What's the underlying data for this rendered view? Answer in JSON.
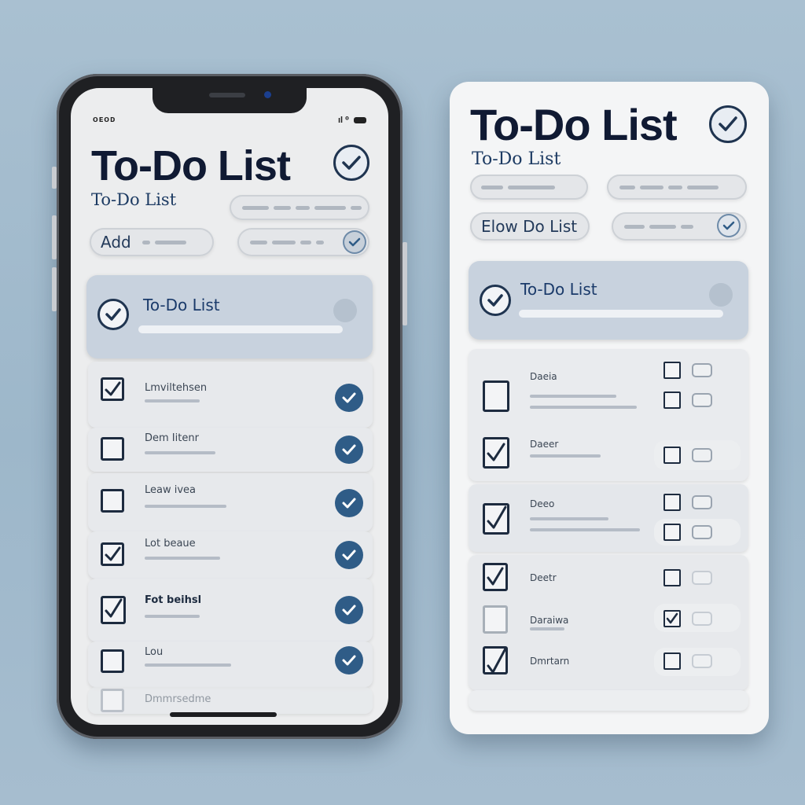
{
  "phone": {
    "status_left": "ᴏᴇᴏᴅ",
    "status_right": "ıl ⁰",
    "title": "To-Do List",
    "subtitle": "To-Do List",
    "add_label": "Add",
    "panel_label": "To-Do List",
    "rows": [
      {
        "label": "Lmviltehsen",
        "checked": true
      },
      {
        "label": "Dem Iitenr",
        "checked": false
      },
      {
        "label": "Leaw ivea",
        "checked": false
      },
      {
        "label": "Lot beaue",
        "checked": true
      },
      {
        "label": "Fot beihsl",
        "checked": true
      },
      {
        "label": "Lou",
        "checked": false
      },
      {
        "label": "Dmmrsedme",
        "checked": false
      }
    ]
  },
  "card": {
    "title": "To-Do List",
    "subtitle": "To-Do List",
    "filter_label": "Elow Do List",
    "panel_label": "To-Do List",
    "rows": [
      {
        "label": "Daeia",
        "checked": false
      },
      {
        "label": "Daeer",
        "checked": true
      },
      {
        "label": "Deeo",
        "checked": true
      },
      {
        "label": "Deetr",
        "checked": true
      },
      {
        "label": "Daraiwa",
        "checked": false
      },
      {
        "label": "Dmrtarn",
        "checked": true
      }
    ]
  },
  "colors": {
    "background": "#a9c0d1",
    "navy_text": "#101a33",
    "accent_blue": "#2f5c87",
    "screen": "#ecedee"
  },
  "icons": [
    "check-icon",
    "checkmark-circle-icon",
    "battery-icon",
    "camera-icon"
  ]
}
